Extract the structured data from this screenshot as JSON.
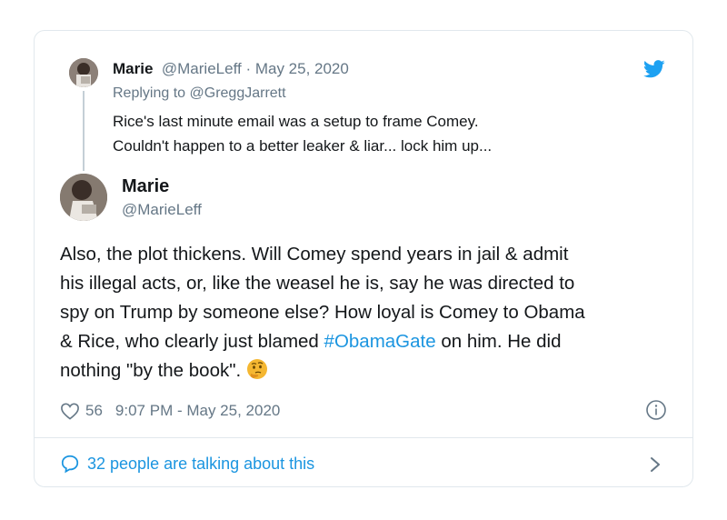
{
  "reply": {
    "name": "Marie",
    "handle": "@MarieLeff",
    "separator": " · ",
    "date": "May 25, 2020",
    "replying_to_prefix": "Replying to ",
    "replying_to_handle": "@GreggJarrett",
    "lines": [
      "Rice's last minute email was a setup to frame Comey.",
      "Couldn't happen to a better leaker & liar... lock him up..."
    ]
  },
  "tweet": {
    "name": "Marie",
    "handle": "@MarieLeff",
    "line1": "Also, the plot thickens. Will Comey spend years in jail & admit",
    "line2": "his illegal acts, or, like the weasel he is, say he was directed to",
    "line3": "spy on Trump by someone else? How loyal is Comey to Obama",
    "line4_pre": "& Rice, who clearly just blamed ",
    "hashtag": "#ObamaGate",
    "line4_post": " on him. He did",
    "line5": "nothing \"by the book\".",
    "emoji": "thinking-face-emoji",
    "likes": "56",
    "timestamp": "9:07 PM - May 25, 2020"
  },
  "footer": {
    "talking": "32 people are talking about this"
  },
  "icons": {
    "bird": "twitter-bird-icon",
    "heart": "heart-icon",
    "info": "info-icon",
    "comment": "comment-bubble-icon",
    "chevron": "chevron-right-icon"
  },
  "colors": {
    "accent": "#1da1f2",
    "link": "#1b95e0",
    "muted": "#657786",
    "border": "#e1e8ed"
  }
}
